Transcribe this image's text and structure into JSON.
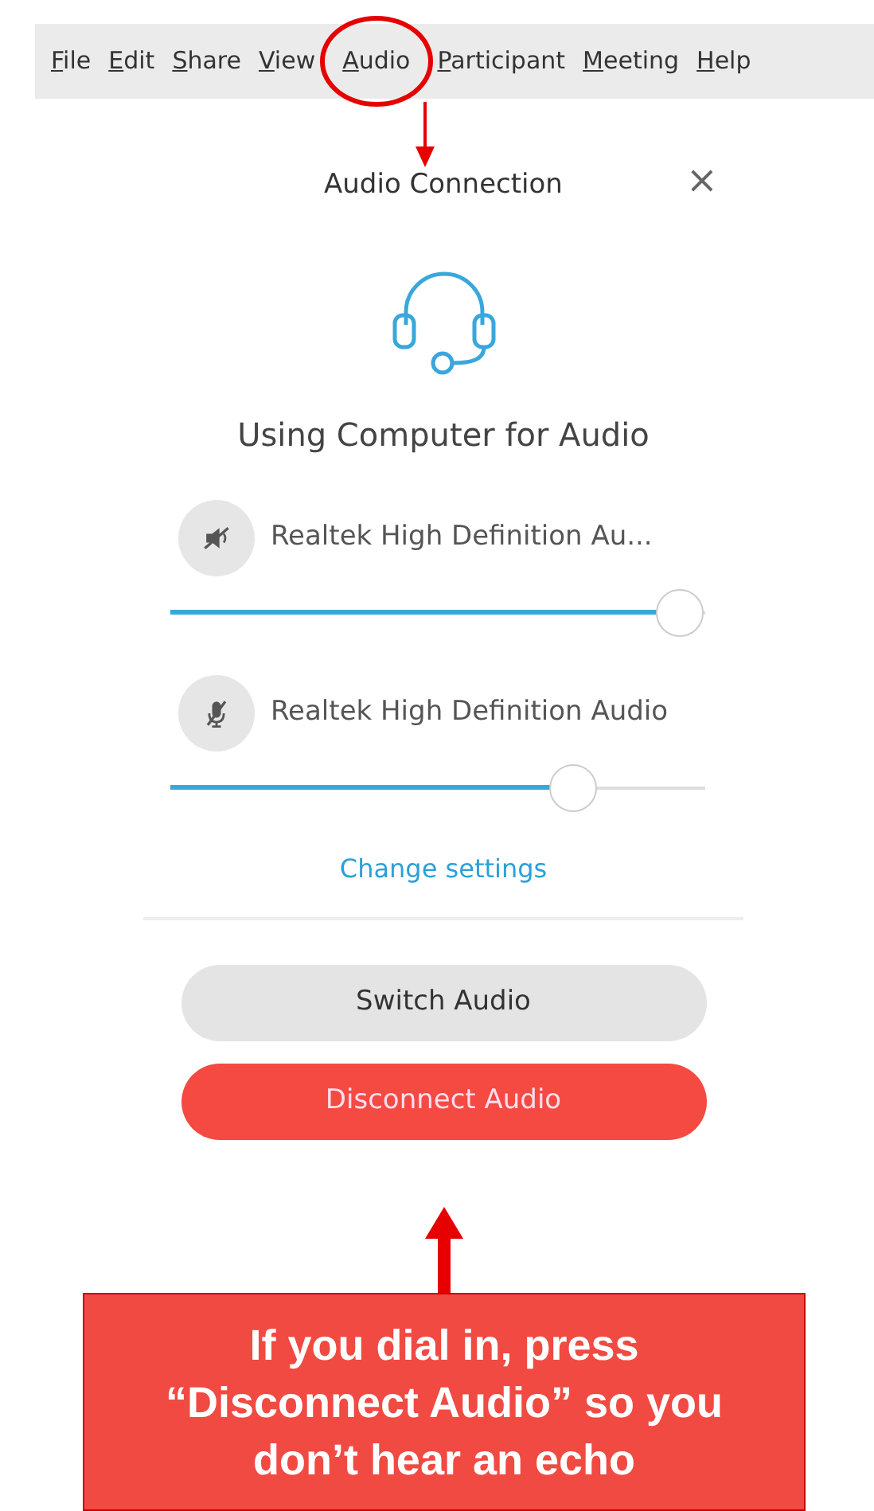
{
  "menu_bar": {
    "items": [
      {
        "label": "File",
        "selected": false
      },
      {
        "label": "Edit",
        "selected": false
      },
      {
        "label": "Share",
        "selected": false
      },
      {
        "label": "View",
        "selected": false
      },
      {
        "label": "Audio",
        "selected": true
      },
      {
        "label": "Participant",
        "selected": false
      },
      {
        "label": "Meeting",
        "selected": false
      },
      {
        "label": "Help",
        "selected": false
      }
    ]
  },
  "dialog": {
    "title": "Audio Connection",
    "close": "×",
    "heading": "Using Computer for Audio",
    "devices": [
      {
        "kind": "speaker",
        "name": "Realtek High Definition Au...",
        "level": 1.0
      },
      {
        "kind": "microphone",
        "name": "Realtek High Definition Audio",
        "level": 0.79
      }
    ],
    "link": "Change settings",
    "buttons": [
      {
        "kind": "secondary",
        "label": "Switch Audio"
      },
      {
        "kind": "danger",
        "label": "Disconnect Audio"
      }
    ]
  },
  "callout": {
    "text": "If you dial in, press “Disconnect Audio” so you don’t hear an echo"
  }
}
